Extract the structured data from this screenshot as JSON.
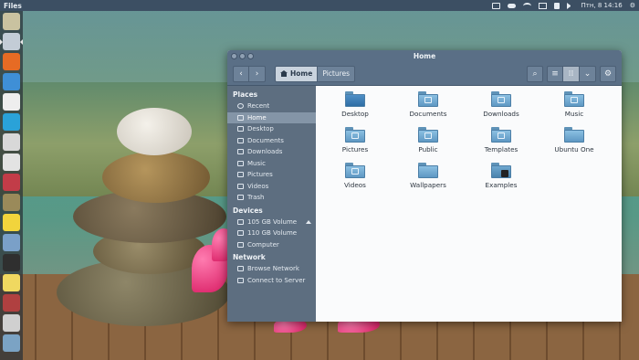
{
  "top_panel": {
    "app_title": "Files",
    "clock": "Птн, 8 14:16",
    "indicators": [
      "keyboard-icon",
      "cloud-icon",
      "network-icon",
      "mail-icon",
      "lock-icon",
      "volume-icon",
      "gear-icon"
    ]
  },
  "launcher": {
    "items": [
      {
        "name": "dash-home-icon",
        "color": "#c9c2a0"
      },
      {
        "name": "files-icon",
        "color": "#c3ccd6"
      },
      {
        "name": "firefox-icon",
        "color": "#e66b24"
      },
      {
        "name": "chromium-icon",
        "color": "#3f8fd6"
      },
      {
        "name": "document-icon",
        "color": "#eeeeee"
      },
      {
        "name": "software-center-icon",
        "color": "#2aa2d8"
      },
      {
        "name": "system-settings-icon",
        "color": "#d8d8d8"
      },
      {
        "name": "text-editor-icon",
        "color": "#e3e3e3"
      },
      {
        "name": "image-viewer-icon",
        "color": "#c23c48"
      },
      {
        "name": "disk-icon",
        "color": "#9a8a5a"
      },
      {
        "name": "notes-icon",
        "color": "#f1d43c"
      },
      {
        "name": "screenshot-icon",
        "color": "#7aa0c8"
      },
      {
        "name": "terminal-icon",
        "color": "#2f2f2f"
      },
      {
        "name": "updater-icon",
        "color": "#f0d860"
      },
      {
        "name": "settings-panel-icon",
        "color": "#b04040"
      },
      {
        "name": "drive-icon",
        "color": "#d0d0d0"
      },
      {
        "name": "trash-icon",
        "color": "#7ba3c4"
      }
    ]
  },
  "window": {
    "title": "Home",
    "breadcrumbs": [
      {
        "label": "Home",
        "current": true
      },
      {
        "label": "Pictures",
        "current": false
      }
    ]
  },
  "sidebar": {
    "sections": [
      {
        "heading": "Places",
        "items": [
          {
            "label": "Recent",
            "icon": "clock-icon",
            "selected": false
          },
          {
            "label": "Home",
            "icon": "home-icon",
            "selected": true
          },
          {
            "label": "Desktop",
            "icon": "desktop-icon",
            "selected": false
          },
          {
            "label": "Documents",
            "icon": "documents-icon",
            "selected": false
          },
          {
            "label": "Downloads",
            "icon": "downloads-icon",
            "selected": false
          },
          {
            "label": "Music",
            "icon": "music-icon",
            "selected": false
          },
          {
            "label": "Pictures",
            "icon": "pictures-icon",
            "selected": false
          },
          {
            "label": "Videos",
            "icon": "videos-icon",
            "selected": false
          },
          {
            "label": "Trash",
            "icon": "trash-icon",
            "selected": false
          }
        ]
      },
      {
        "heading": "Devices",
        "items": [
          {
            "label": "105 GB Volume",
            "icon": "drive-icon",
            "selected": false,
            "eject": true
          },
          {
            "label": "110 GB Volume",
            "icon": "drive-icon",
            "selected": false
          },
          {
            "label": "Computer",
            "icon": "computer-icon",
            "selected": false
          }
        ]
      },
      {
        "heading": "Network",
        "items": [
          {
            "label": "Browse Network",
            "icon": "network-icon",
            "selected": false
          },
          {
            "label": "Connect to Server",
            "icon": "server-icon",
            "selected": false
          }
        ]
      }
    ]
  },
  "files": [
    {
      "label": "Desktop",
      "kind": "desktop"
    },
    {
      "label": "Documents",
      "kind": "documents"
    },
    {
      "label": "Downloads",
      "kind": "downloads"
    },
    {
      "label": "Music",
      "kind": "music"
    },
    {
      "label": "Pictures",
      "kind": "pictures"
    },
    {
      "label": "Public",
      "kind": "public"
    },
    {
      "label": "Templates",
      "kind": "templates"
    },
    {
      "label": "Ubuntu One",
      "kind": "plain"
    },
    {
      "label": "Videos",
      "kind": "videos"
    },
    {
      "label": "Wallpapers",
      "kind": "plain"
    },
    {
      "label": "Examples",
      "kind": "examples"
    }
  ]
}
